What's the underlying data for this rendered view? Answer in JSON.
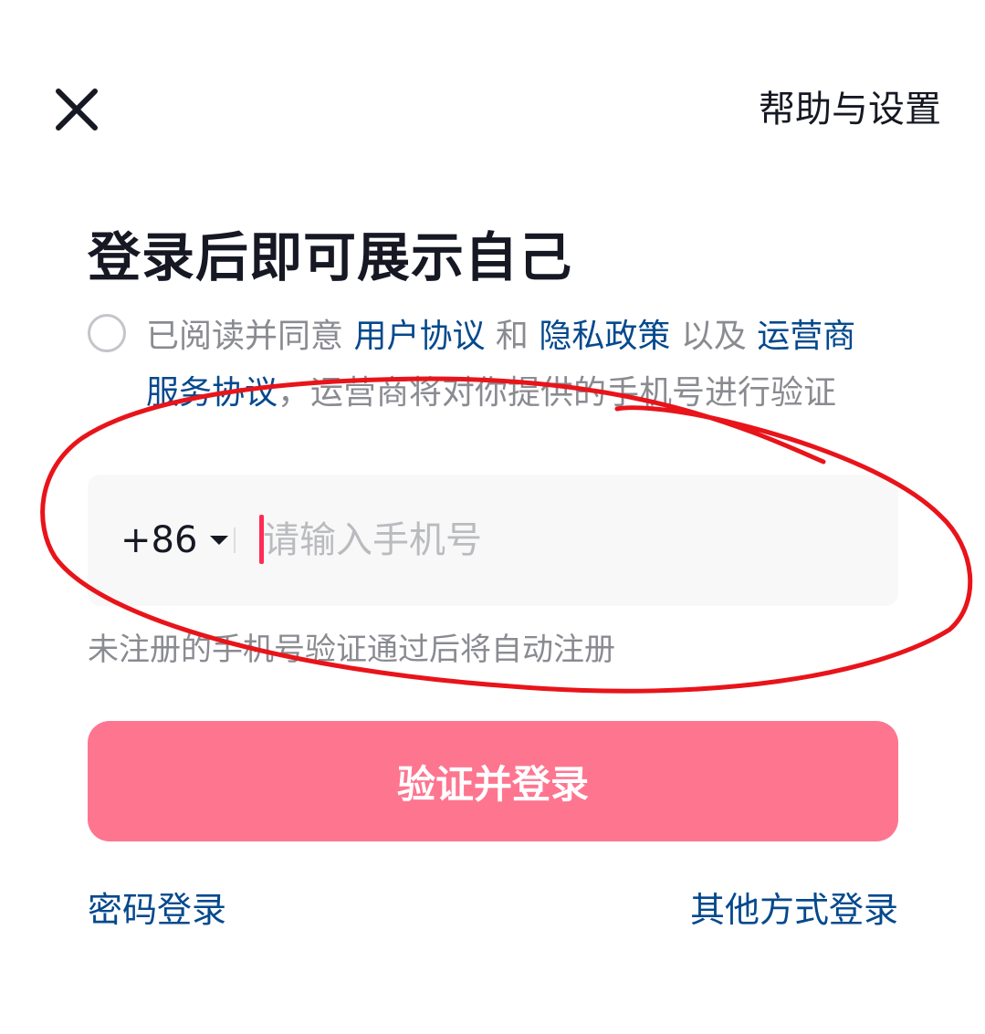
{
  "header": {
    "close_icon": "close-icon",
    "help_label": "帮助与设置"
  },
  "title": "登录后即可展示自己",
  "agreement": {
    "prefix": "已阅读并同意 ",
    "user_agreement": "用户协议",
    "and": " 和 ",
    "privacy_policy": "隐私政策",
    "also": " 以及 ",
    "carrier_agreement": "运营商服务协议",
    "suffix": "，运营商将对你提供的手机号进行验证"
  },
  "phone": {
    "country_code": "+86",
    "placeholder": "请输入手机号",
    "value": ""
  },
  "hint": "未注册的手机号验证通过后将自动注册",
  "submit_label": "验证并登录",
  "footer": {
    "password_login": "密码登录",
    "other_login": "其他方式登录"
  },
  "colors": {
    "primary_button": "#fe7590",
    "link": "#04498d",
    "cursor": "#fe2c55",
    "annotation": "#e8141a"
  }
}
